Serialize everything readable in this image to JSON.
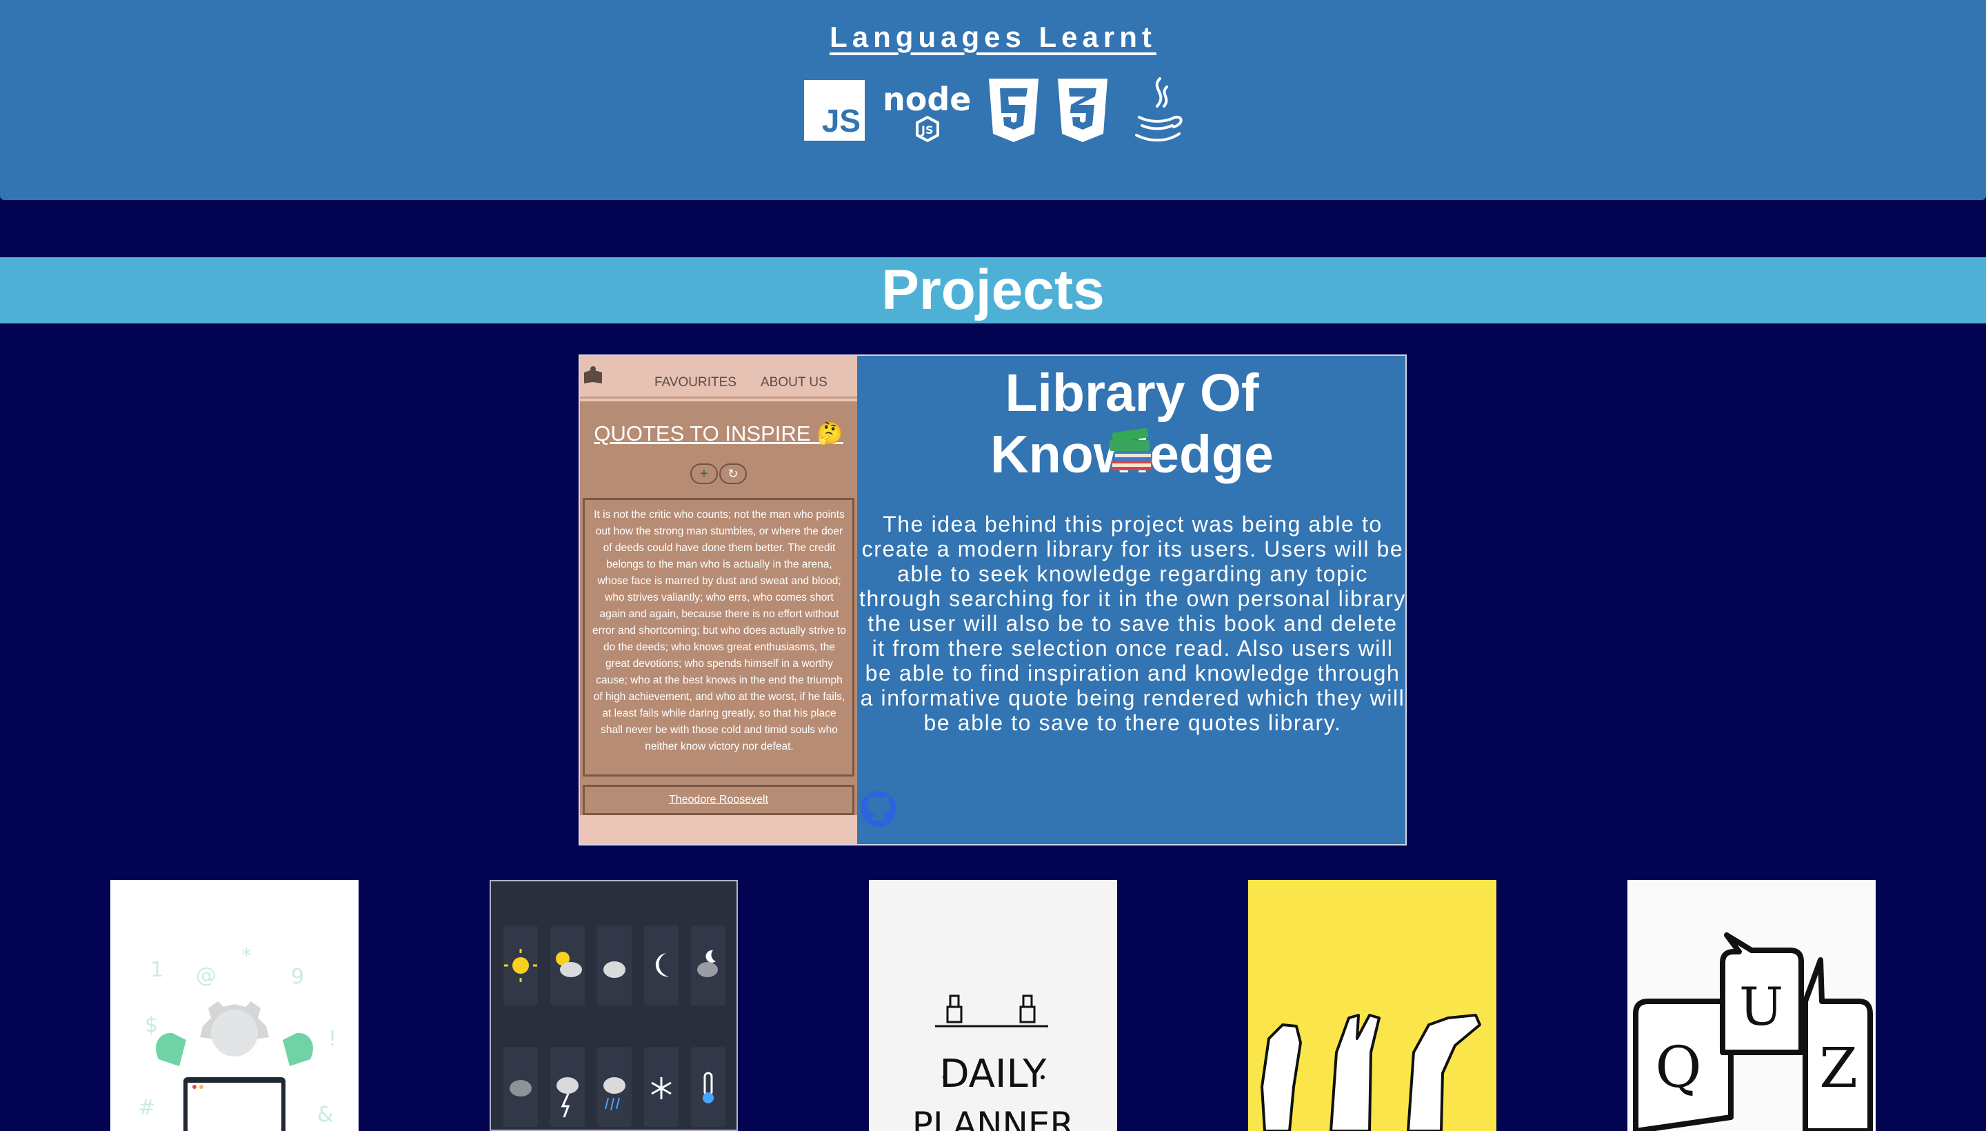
{
  "languages": {
    "title": "Languages Learnt",
    "icons": [
      "javascript-icon",
      "nodejs-icon",
      "html5-icon",
      "css3-icon",
      "java-icon"
    ],
    "js_label": "JS"
  },
  "projects": {
    "title": "Projects"
  },
  "featured": {
    "title": "Library Of Knowledge",
    "emoji": "books-emoji",
    "description": "The idea behind this project was being able to create a modern library for its users. Users will be able to seek knowledge regarding any topic through searching for it in the own personal library the user will also be to save this book and delete it from there selection once read. Also users will be able to find inspiration and knowledge through a informative quote being rendered which they will be able to save to there quotes library.",
    "screenshot": {
      "nav": [
        "FAVOURITES",
        "ABOUT US"
      ],
      "quote_title": "QUOTES TO INSPIRE 🤔",
      "add_btn": "+",
      "refresh_btn": "↻",
      "quote": "It is not the critic who counts; not the man who points out how the strong man stumbles, or where the doer of deeds could have done them better. The credit belongs to the man who is actually in the arena, whose face is marred by dust and sweat and blood; who strives valiantly; who errs, who comes short again and again, because there is no effort without error and shortcoming; but who does actually strive to do the deeds; who knows great enthusiasms, the great devotions; who spends himself in a worthy cause; who at the best knows in the end the triumph of high achievement, and who at the worst, if he fails, at least fails while daring greatly, so that his place shall never be with those cold and timid souls who neither know victory nor defeat.",
      "author": "Theodore Roosevelt"
    },
    "link_icon": "github-icon"
  },
  "cards": [
    {
      "name": "password-generator-project-card",
      "art": "tech-support-illustration"
    },
    {
      "name": "weather-dashboard-project-card",
      "art": "weather-icons-grid"
    },
    {
      "name": "daily-planner-project-card",
      "art": "daily-planner-sketch",
      "text": "DAILY PLANNER"
    },
    {
      "name": "rock-paper-scissors-project-card",
      "art": "hands-illustration"
    },
    {
      "name": "quiz-project-card",
      "art": "quiz-speech-bubbles",
      "letters": [
        "Q",
        "U",
        "I",
        "Z"
      ]
    }
  ],
  "colors": {
    "background": "#020452",
    "header": "#3374b2",
    "banner": "#4fb0d6"
  }
}
